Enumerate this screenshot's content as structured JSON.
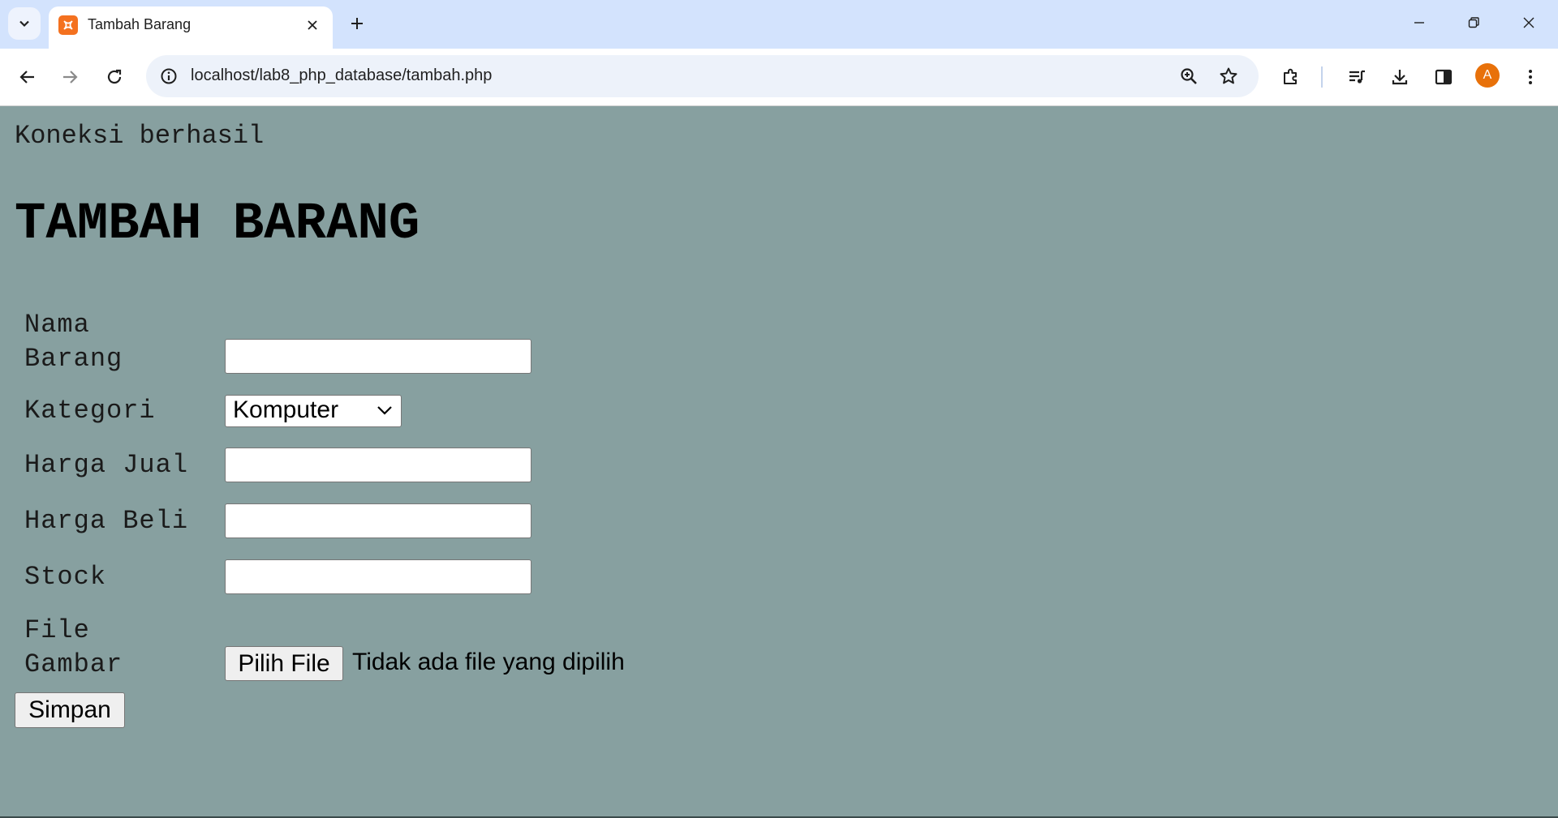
{
  "browser": {
    "tab_title": "Tambah Barang",
    "url": "localhost/lab8_php_database/tambah.php",
    "profile_initial": "A"
  },
  "page": {
    "status_text": "Koneksi berhasil",
    "heading": "TAMBAH BARANG",
    "form": {
      "nama_barang_label_line1": "Nama",
      "nama_barang_label_line2": "Barang",
      "nama_barang_value": "",
      "kategori_label": "Kategori",
      "kategori_selected": "Komputer",
      "harga_jual_label": "Harga Jual",
      "harga_jual_value": "",
      "harga_beli_label": "Harga Beli",
      "harga_beli_value": "",
      "stock_label": "Stock",
      "stock_value": "",
      "file_label_line1": "File",
      "file_label_line2": "Gambar",
      "file_button_label": "Pilih File",
      "file_status": "Tidak ada file yang dipilih",
      "submit_label": "Simpan"
    }
  },
  "colors": {
    "page_background": "#87a0a0",
    "tabbar_background": "#d3e3fd",
    "favicon": "#f4711f",
    "avatar": "#e8710a"
  }
}
